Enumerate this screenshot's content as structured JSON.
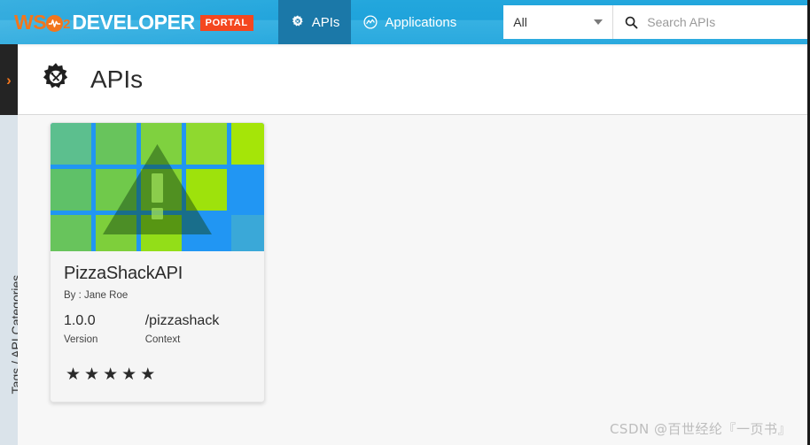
{
  "header": {
    "logo": {
      "brand_prefix": "WS",
      "brand_sub": "2",
      "brand_word": "DEVELOPER",
      "badge": "PORTAL",
      "brand_color": "#f2761d",
      "badge_color": "#f4471f"
    },
    "tabs": [
      {
        "label": "APIs",
        "icon": "gear-api-icon",
        "active": true
      },
      {
        "label": "Applications",
        "icon": "application-circle-icon",
        "active": false
      }
    ],
    "filter_select": {
      "value": "All",
      "icon": "chevron-down-icon"
    },
    "search": {
      "placeholder": "Search APIs",
      "value": "",
      "icon": "search-icon"
    },
    "info_icon": "info-circle-icon",
    "background_color": "#23a7dd"
  },
  "sidebar": {
    "toggle_icon": "chevron-right-icon",
    "label": "Tags / API Categories",
    "dark_color": "#242424",
    "light_color": "#dae3ea"
  },
  "page": {
    "title": "APIs",
    "title_icon": "gear-tools-icon"
  },
  "api_card": {
    "thumbnail_icon": "broken-image-placeholder",
    "name": "PizzaShackAPI",
    "author_label": "By : Jane Roe",
    "version_value": "1.0.0",
    "version_label": "Version",
    "context_value": "/pizzashack",
    "context_label": "Context",
    "rating": 5,
    "star_glyph": "★"
  },
  "watermark": {
    "text": "CSDN @百世经纶『一页书』"
  }
}
